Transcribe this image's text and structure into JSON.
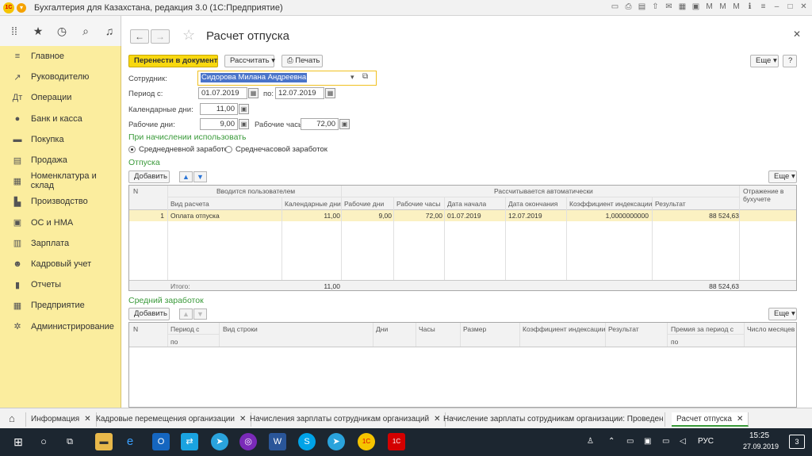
{
  "window": {
    "title": "Бухгалтерия для Казахстана, редакция 3.0  (1С:Предприятие)"
  },
  "topbar_icons": [
    "apps-grid-icon",
    "star-icon",
    "history-icon",
    "search-icon",
    "bell-icon"
  ],
  "sidebar": {
    "items": [
      {
        "label": "Главное",
        "icon": "menu-icon"
      },
      {
        "label": "Руководителю",
        "icon": "chart-icon"
      },
      {
        "label": "Операции",
        "icon": "operations-icon"
      },
      {
        "label": "Банк и касса",
        "icon": "bank-icon"
      },
      {
        "label": "Покупка",
        "icon": "cart-icon"
      },
      {
        "label": "Продажа",
        "icon": "sale-icon"
      },
      {
        "label": "Номенклатура и склад",
        "icon": "warehouse-icon"
      },
      {
        "label": "Производство",
        "icon": "factory-icon"
      },
      {
        "label": "ОС и НМА",
        "icon": "assets-icon"
      },
      {
        "label": "Зарплата",
        "icon": "salary-icon"
      },
      {
        "label": "Кадровый учет",
        "icon": "hr-icon"
      },
      {
        "label": "Отчеты",
        "icon": "reports-icon"
      },
      {
        "label": "Предприятие",
        "icon": "enterprise-icon"
      },
      {
        "label": "Администрирование",
        "icon": "admin-icon"
      }
    ]
  },
  "form": {
    "title": "Расчет отпуска",
    "toolbar": {
      "transfer": "Перенести в документ",
      "calculate": "Рассчитать",
      "print": "Печать",
      "more": "Еще",
      "help": "?"
    },
    "employee_label": "Сотрудник:",
    "employee_value": "Сидорова Милана Андреевна",
    "period_label": "Период с:",
    "period_from": "01.07.2019",
    "period_to_label": "по:",
    "period_to": "12.07.2019",
    "calendar_days_label": "Календарные дни:",
    "calendar_days": "11,00",
    "work_days_label": "Рабочие дни:",
    "work_days": "9,00",
    "work_hours_label": "Рабочие часы:",
    "work_hours": "72,00",
    "accrual_section": "При начислении использовать",
    "radio_avg_earnings": "Среднедневной заработок",
    "radio_avg_hourly": "Среднечасовой заработок"
  },
  "vacations": {
    "section": "Отпуска",
    "add": "Добавить",
    "more": "Еще",
    "group_user": "Вводится пользователем",
    "group_auto": "Рассчитывается автоматически",
    "columns": {
      "n": "N",
      "calc_type": "Вид расчета",
      "cal_days": "Календарные дни",
      "work_days": "Рабочие дни",
      "work_hours": "Рабочие часы",
      "start": "Дата начала",
      "end": "Дата окончания",
      "coef": "Коэффициент индексации",
      "result": "Результат",
      "reflection": "Отражение в бухучете"
    },
    "row": {
      "n": "1",
      "calc_type": "Оплата отпуска",
      "cal_days": "11,00",
      "work_days": "9,00",
      "work_hours": "72,00",
      "start": "01.07.2019",
      "end": "12.07.2019",
      "coef": "1,0000000000",
      "result": "88 524,63"
    },
    "total_label": "Итого:",
    "total_days": "11,00",
    "total_result": "88 524,63"
  },
  "avg_earnings": {
    "section": "Средний заработок",
    "add": "Добавить",
    "more": "Еще",
    "columns": {
      "n": "N",
      "period_from": "Период с",
      "period_to": "по",
      "row_type": "Вид строки",
      "days": "Дни",
      "hours": "Часы",
      "size": "Размер",
      "coef": "Коэффициент индексации",
      "result": "Результат",
      "bonus": "Премия за период с",
      "bonus_to": "по",
      "months": "Число месяцев"
    }
  },
  "tabs": [
    {
      "label": "Информация"
    },
    {
      "label": "Кадровые перемещения организации"
    },
    {
      "label": "Начисления зарплаты сотрудникам организаций"
    },
    {
      "label": "Начисление зарплаты сотрудникам организации: Проведен"
    },
    {
      "label": "Расчет отпуска"
    }
  ],
  "taskbar": {
    "lang": "РУС",
    "time": "15:25",
    "date": "27.09.2019",
    "notif_count": "3"
  },
  "colors": {
    "sidebar_bg": "#fbed9e",
    "primary_button": "#f8d80f",
    "section_green": "#3a9a3a",
    "selected_row": "#fbf1c2",
    "taskbar_bg": "#1c2630"
  }
}
